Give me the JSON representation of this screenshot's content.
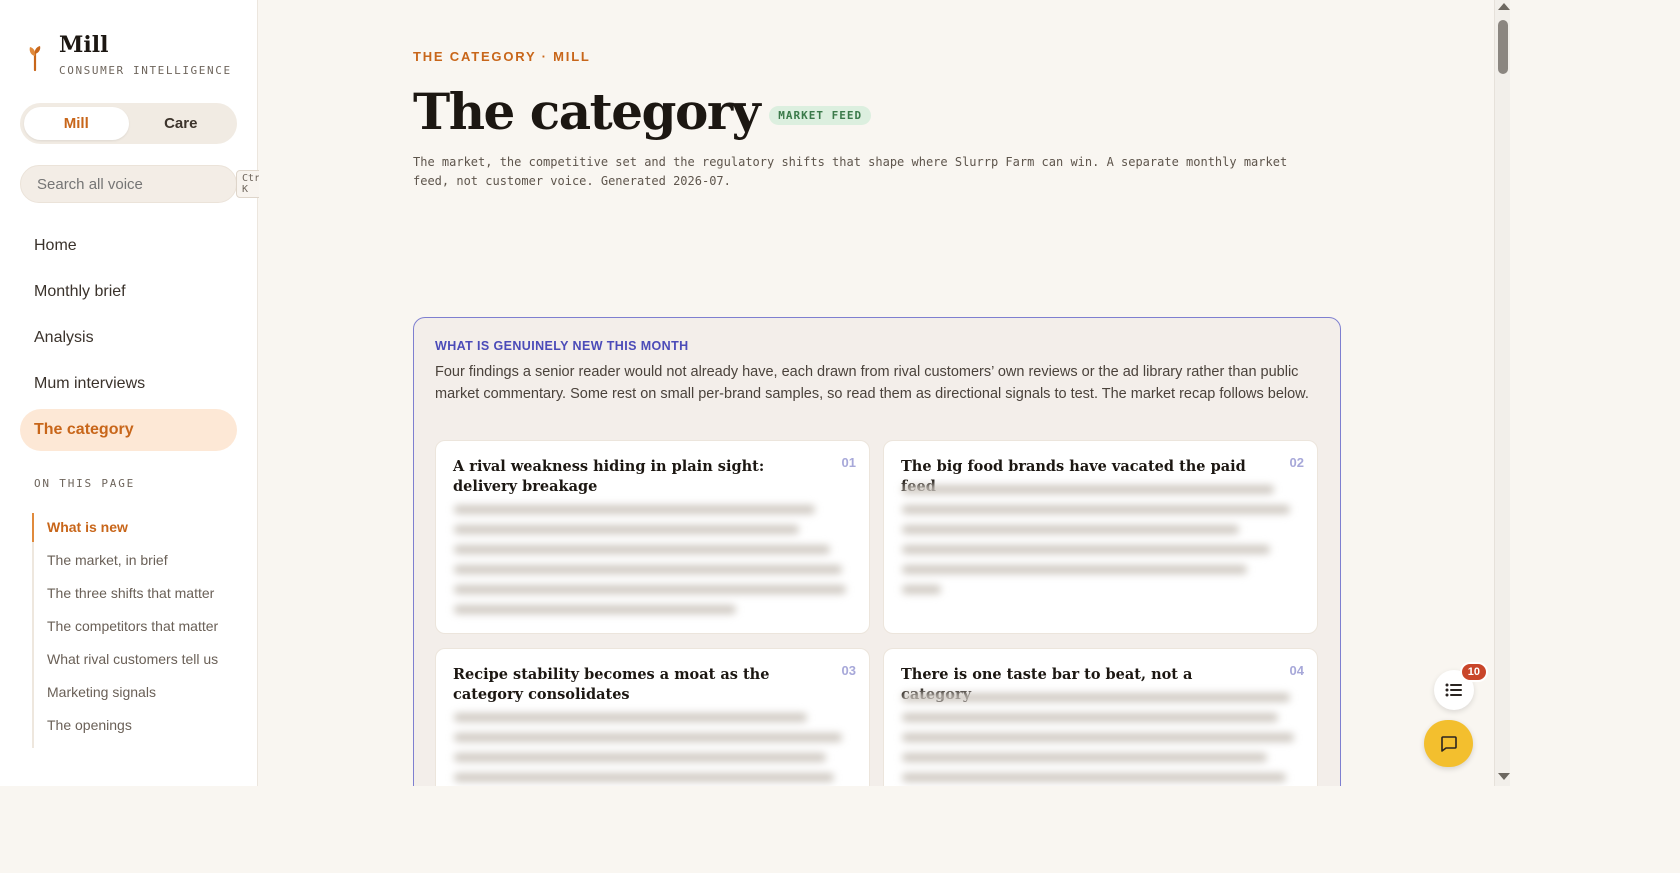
{
  "brand": {
    "name": "Mill",
    "subtitle": "CONSUMER INTELLIGENCE"
  },
  "switcher": {
    "options": [
      "Mill",
      "Care"
    ],
    "selected": "Mill"
  },
  "search": {
    "placeholder": "Search all voice",
    "shortcut": "Ctrl K"
  },
  "nav": {
    "items": [
      "Home",
      "Monthly brief",
      "Analysis",
      "Mum interviews",
      "The category"
    ],
    "active": "The category"
  },
  "on_this_page": {
    "title": "ON THIS PAGE",
    "items": [
      "What is new",
      "The market, in brief",
      "The three shifts that matter",
      "The competitors that matter",
      "What rival customers tell us",
      "Marketing signals",
      "The openings"
    ],
    "active": "What is new"
  },
  "header": {
    "eyebrow": "THE CATEGORY · MILL",
    "title": "The category",
    "badge": "MARKET FEED",
    "lede": "The market, the competitive set and the regulatory shifts that shape where Slurrp Farm can win. A separate monthly market feed, not customer voice. Generated 2026-07."
  },
  "callout": {
    "heading": "WHAT IS GENUINELY NEW THIS MONTH",
    "body": "Four findings a senior reader would not already have, each drawn from rival customers’ own reviews or the ad library rather than public market commentary. Some rest on small per-brand samples, so read them as directional signals to test. The market recap follows below.",
    "cards": [
      {
        "num": "01",
        "title": "A rival weakness hiding in plain sight: delivery breakage"
      },
      {
        "num": "02",
        "title": "The big food brands have vacated the paid feed"
      },
      {
        "num": "03",
        "title": "Recipe stability becomes a moat as the category consolidates"
      },
      {
        "num": "04",
        "title": "There is one taste bar to beat, not a category"
      }
    ]
  },
  "fab": {
    "toc_count": "10"
  },
  "colors": {
    "accent": "#c8661a",
    "callout_border": "#7e7fd0",
    "chat_button": "#f3bf2e",
    "badge_bg": "#dcefdf"
  }
}
